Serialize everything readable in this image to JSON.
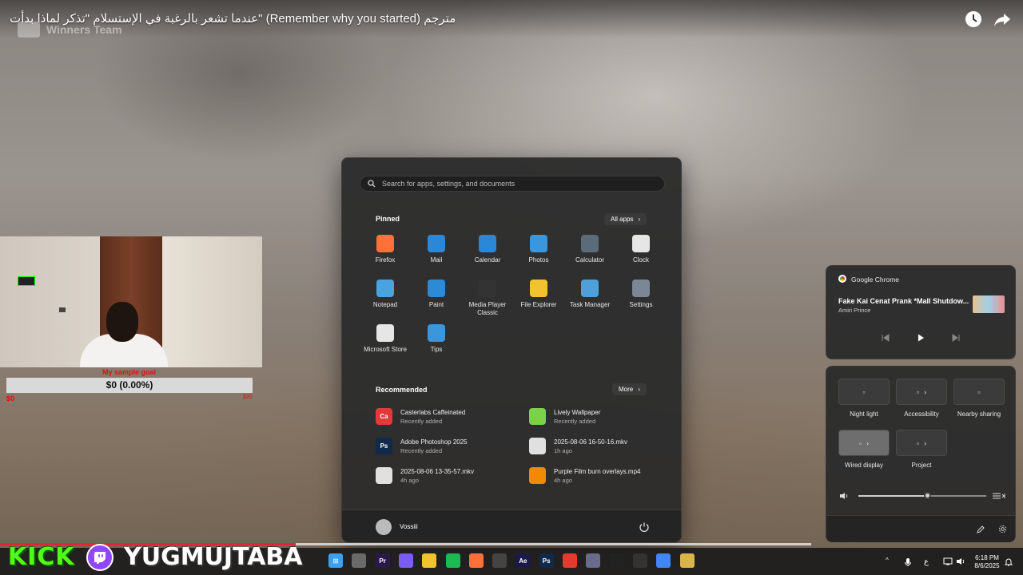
{
  "video": {
    "title": "عندما تشعر بالرغبة في الإستسلام \"تذكر لماذا بدأت\" (Remember why you started) مترجم",
    "watermark": "Winners Team",
    "progress_fraction": 0.365
  },
  "overlay": {
    "goal_title": "My sample goal",
    "goal_value": "$0 (0.00%)",
    "goal_min": "$0",
    "goal_max": "$25",
    "kick_label": "KICK",
    "channel_name": "YUGMUJTABA"
  },
  "start_menu": {
    "search_placeholder": "Search for apps, settings, and documents",
    "pinned_label": "Pinned",
    "all_apps_label": "All apps",
    "pinned": [
      {
        "label": "Firefox",
        "icon": "firefox-icon",
        "color": "#ff7139"
      },
      {
        "label": "Mail",
        "icon": "mail-icon",
        "color": "#2b88d8"
      },
      {
        "label": "Calendar",
        "icon": "calendar-icon",
        "color": "#2b88d8"
      },
      {
        "label": "Photos",
        "icon": "photos-icon",
        "color": "#3a96dd"
      },
      {
        "label": "Calculator",
        "icon": "calculator-icon",
        "color": "#5c6b7a"
      },
      {
        "label": "Clock",
        "icon": "clock-icon",
        "color": "#e6e6e6"
      },
      {
        "label": "Notepad",
        "icon": "notepad-icon",
        "color": "#4aa3df"
      },
      {
        "label": "Paint",
        "icon": "paint-icon",
        "color": "#2d8bd6"
      },
      {
        "label": "Media Player Classic",
        "icon": "media-player-icon",
        "color": "#333333"
      },
      {
        "label": "File Explorer",
        "icon": "folder-icon",
        "color": "#f2c230"
      },
      {
        "label": "Task Manager",
        "icon": "task-manager-icon",
        "color": "#4fa0d8"
      },
      {
        "label": "Settings",
        "icon": "gear-icon",
        "color": "#7a8896"
      },
      {
        "label": "Microsoft Store",
        "icon": "store-icon",
        "color": "#e6e6e6"
      },
      {
        "label": "Tips",
        "icon": "tips-icon",
        "color": "#3a96dd"
      }
    ],
    "recommended_label": "Recommended",
    "more_label": "More",
    "recommended": [
      {
        "title": "Casterlabs Caffeinated",
        "sub": "Recently added",
        "icon": "casterlabs-icon",
        "color": "#e03a3a",
        "glyph": "Ca"
      },
      {
        "title": "Lively Wallpaper",
        "sub": "Recently added",
        "icon": "lively-icon",
        "color": "#7bd248",
        "glyph": ""
      },
      {
        "title": "Adobe Photoshop 2025",
        "sub": "Recently added",
        "icon": "photoshop-icon",
        "color": "#0f2a4a",
        "glyph": "Ps"
      },
      {
        "title": "2025-08-06 16-50-16.mkv",
        "sub": "1h ago",
        "icon": "video-file-icon",
        "color": "#e0e0e0",
        "glyph": ""
      },
      {
        "title": "2025-08-06 13-35-57.mkv",
        "sub": "4h ago",
        "icon": "video-file-icon",
        "color": "#e0e0e0",
        "glyph": ""
      },
      {
        "title": "Purple Film burn overlays.mp4",
        "sub": "4h ago",
        "icon": "vlc-icon",
        "color": "#f08a00",
        "glyph": ""
      }
    ],
    "user_name": "Vossiii"
  },
  "media": {
    "app_name": "Google Chrome",
    "song": "Fake Kai Cenat Prank *Mall Shutdow...",
    "artist": "Amiri Prince"
  },
  "quick_settings": {
    "tiles": [
      {
        "label": "Night light",
        "icon": "night-light-icon",
        "active": false,
        "arrow": false
      },
      {
        "label": "Accessibility",
        "icon": "accessibility-icon",
        "active": false,
        "arrow": true
      },
      {
        "label": "Nearby sharing",
        "icon": "share-icon",
        "active": false,
        "arrow": false
      },
      {
        "label": "Wired display",
        "icon": "display-icon",
        "active": true,
        "arrow": true
      },
      {
        "label": "Project",
        "icon": "project-icon",
        "active": false,
        "arrow": true
      }
    ],
    "volume_fraction": 0.54
  },
  "taskbar": {
    "tray_input": "ع",
    "time": "6:18 PM",
    "date": "8/6/2025",
    "apps": [
      {
        "name": "start-icon",
        "color": "#3aa0f0",
        "glyph": "⊞"
      },
      {
        "name": "task-view-icon",
        "color": "#6a6a6a",
        "glyph": ""
      },
      {
        "name": "premiere-icon",
        "color": "#2a1a4a",
        "glyph": "Pr"
      },
      {
        "name": "copilot-icon",
        "color": "#7a5cf0",
        "glyph": ""
      },
      {
        "name": "file-explorer-icon",
        "color": "#f2c230",
        "glyph": ""
      },
      {
        "name": "spotify-icon",
        "color": "#1db954",
        "glyph": ""
      },
      {
        "name": "firefox-icon",
        "color": "#ff7139",
        "glyph": ""
      },
      {
        "name": "clapper-icon",
        "color": "#444444",
        "glyph": ""
      },
      {
        "name": "after-effects-icon",
        "color": "#1a1a4a",
        "glyph": "Ae"
      },
      {
        "name": "photoshop-icon",
        "color": "#0f2a4a",
        "glyph": "Ps"
      },
      {
        "name": "chrome-icon",
        "color": "#e33b2e",
        "glyph": ""
      },
      {
        "name": "edge-icon",
        "color": "#6a6a8a",
        "glyph": ""
      },
      {
        "name": "capcut-icon",
        "color": "#222222",
        "glyph": ""
      },
      {
        "name": "obs-icon",
        "color": "#333333",
        "glyph": ""
      },
      {
        "name": "chrome-alt-icon",
        "color": "#4285f4",
        "glyph": ""
      },
      {
        "name": "media-app-icon",
        "color": "#d8b44a",
        "glyph": ""
      }
    ]
  }
}
